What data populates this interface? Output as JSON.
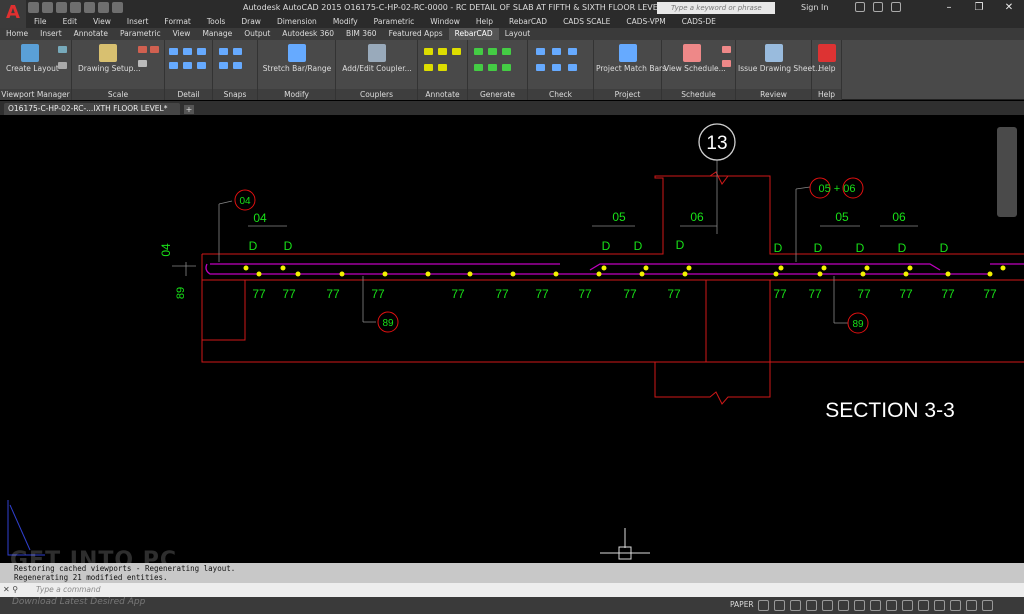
{
  "titlebar": {
    "title": "Autodesk AutoCAD 2015    O16175-C-HP-02-RC-0000 - RC DETAIL OF SLAB AT FIFTH & SIXTH FLOOR LEVEL.dwg",
    "search_placeholder": "Type a keyword or phrase",
    "sign_in": "Sign In"
  },
  "menu": [
    "File",
    "Edit",
    "View",
    "Insert",
    "Format",
    "Tools",
    "Draw",
    "Dimension",
    "Modify",
    "Parametric",
    "Window",
    "Help",
    "RebarCAD",
    "CADS SCALE",
    "CADS-VPM",
    "CADS-DE"
  ],
  "ribbon_tabs": [
    "Home",
    "Insert",
    "Annotate",
    "Parametric",
    "View",
    "Manage",
    "Output",
    "Autodesk 360",
    "BIM 360",
    "Featured Apps",
    "RebarCAD",
    "Layout"
  ],
  "ribbon_active_tab": "RebarCAD",
  "ribbon": {
    "create_layout": "Create Layout",
    "drawing_setup": "Drawing Setup...",
    "stretch_bar": "Stretch Bar/Range",
    "add_coupler": "Add/Edit Coupler...",
    "project_match": "Project Match Bars",
    "view_schedule": "View Schedule...",
    "issue_drawing": "Issue Drawing Sheet...",
    "help": "Help",
    "groups": {
      "viewport": "Viewport Manager",
      "scale": "Scale",
      "detail": "Detail",
      "snaps": "Snaps",
      "modify": "Modify",
      "couplers": "Couplers",
      "annotate": "Annotate",
      "generate": "Generate",
      "check": "Check",
      "project": "Project",
      "schedule": "Schedule",
      "review": "Review",
      "help": "Help"
    }
  },
  "document_tab": "O16175-C-HP-02-RC-...IXTH FLOOR LEVEL*",
  "drawing": {
    "section_number": "13",
    "section_title": "SECTION 3-3",
    "callout_04": "04",
    "callout_05_06": "05 + 06",
    "callout_89_a": "89",
    "callout_89_b": "89",
    "dim_04": "04",
    "dim_05_a": "05",
    "dim_06_a": "06",
    "dim_05_b": "05",
    "dim_06_b": "06",
    "left_dim_04": "04",
    "left_dim_89": "89",
    "d_label": "D",
    "bar_label": "77",
    "colors": {
      "slab": "#d01818",
      "bar": "#c000c0",
      "text": "#18e018",
      "dot": "#f2f000",
      "callout": "#e01010"
    }
  },
  "command": {
    "history": [
      "Restoring cached viewports - Regenerating layout.",
      "Regenerating 21 modified entities."
    ],
    "placeholder": "Type a command"
  },
  "status": {
    "space": "PAPER"
  },
  "watermark": {
    "big": "GET INTO PC",
    "small": "Download Latest Desired App"
  }
}
